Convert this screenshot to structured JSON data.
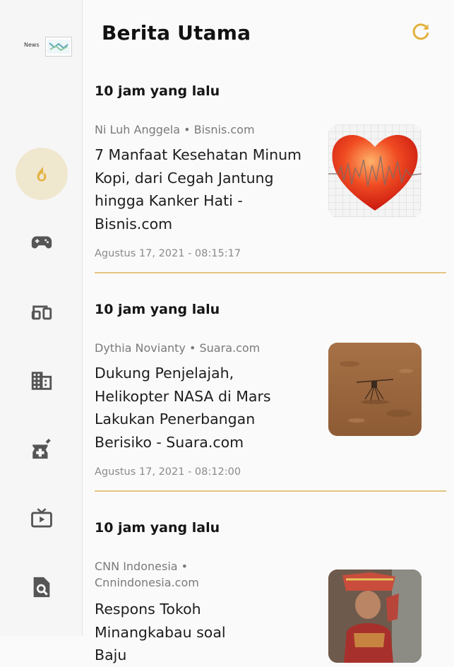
{
  "app": {
    "logo_text": "News"
  },
  "sidebar": {
    "items": [
      {
        "icon": "fire-icon",
        "active": true
      },
      {
        "icon": "gamepad-icon",
        "active": false
      },
      {
        "icon": "devices-icon",
        "active": false
      },
      {
        "icon": "building-icon",
        "active": false
      },
      {
        "icon": "medical-icon",
        "active": false
      },
      {
        "icon": "tv-icon",
        "active": false
      },
      {
        "icon": "search-document-icon",
        "active": false
      }
    ]
  },
  "header": {
    "title": "Berita Utama",
    "refresh_icon": "refresh-icon"
  },
  "colors": {
    "accent": "#e2b13c",
    "active_bg": "#f0e7cf",
    "divider": "#e3c680"
  },
  "articles": [
    {
      "time_ago": "10 jam yang lalu",
      "meta": "Ni Luh Anggela • Bisnis.com",
      "headline": "7 Manfaat Kesehatan Minum Kopi, dari Cegah Jantung hingga Kanker Hati - Bisnis.com",
      "date": "Agustus 17, 2021 - 08:15:17"
    },
    {
      "time_ago": "10 jam yang lalu",
      "meta": "Dythia Novianty • Suara.com",
      "headline": "Dukung Penjelajah, Helikopter NASA di Mars Lakukan Penerbangan Berisiko - Suara.com",
      "date": "Agustus 17, 2021 - 08:12:00"
    },
    {
      "time_ago": "10 jam yang lalu",
      "meta": "CNN Indonesia • Cnnindonesia.com",
      "headline": "Respons Tokoh Minangkabau soal Baju"
    }
  ]
}
